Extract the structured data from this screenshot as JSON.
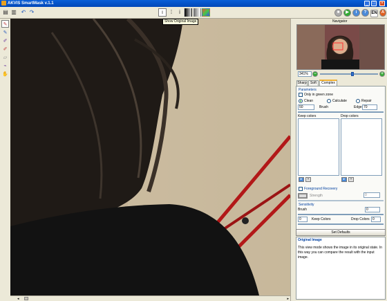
{
  "app": {
    "title": "AKVIS SmartMask v.1.1"
  },
  "tooltip": {
    "text": "Show Original Image"
  },
  "toolbar": {
    "lang": "EN"
  },
  "navigator": {
    "title": "Navigator",
    "zoom": "341%",
    "zoom_level": 0.55
  },
  "tabs": [
    {
      "label": "Sharp"
    },
    {
      "label": "Soft"
    },
    {
      "label": "Complex"
    }
  ],
  "parameters": {
    "title": "Parameters",
    "only_green": "Only in green zone",
    "modes": [
      {
        "label": "Clean"
      },
      {
        "label": "Calculate"
      },
      {
        "label": "Repair"
      }
    ],
    "brush_label": "Brush",
    "brush_value": "50",
    "edge_label": "Edge",
    "edge_value": "70",
    "keep_colors": "Keep colors",
    "drop_colors": "Drop colors"
  },
  "foreground": {
    "title": "Foreground Recovery",
    "strength_label": "Strength",
    "strength_value": "0"
  },
  "sensitivity": {
    "title": "Sensitivity",
    "brush_label": "Brush",
    "brush_value": "0",
    "keep_value": "0",
    "keep_label": "Keep Colors",
    "drop_label": "Drop Colors",
    "drop_value": "0"
  },
  "set_defaults": "Set Defaults",
  "info": {
    "title": "Original Image",
    "body": "This view mode shows the image in its original state. In this way you can compare the result with the input image."
  },
  "colors": {
    "accent": "#0047b8",
    "close": "#d84a20",
    "tab_highlight": "#f0b030"
  }
}
